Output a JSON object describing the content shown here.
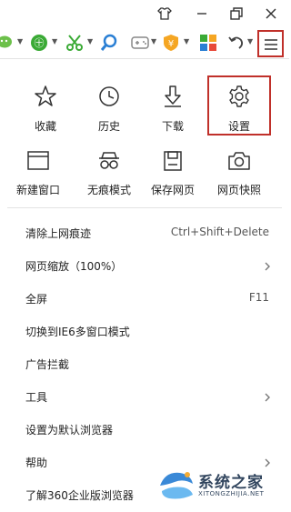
{
  "titlebar": {
    "icons": [
      "skin-icon",
      "minimize-icon",
      "restore-icon",
      "close-icon"
    ]
  },
  "toolbar": {
    "icons": [
      "wechat-icon",
      "green-circle-icon",
      "scissors-icon",
      "search-icon",
      "game-controller-icon",
      "shield-yen-icon",
      "apps-grid-icon",
      "undo-icon",
      "menu-icon"
    ]
  },
  "grid_row1": [
    {
      "label": "收藏",
      "icon": "star-icon"
    },
    {
      "label": "历史",
      "icon": "clock-icon"
    },
    {
      "label": "下载",
      "icon": "download-icon"
    },
    {
      "label": "设置",
      "icon": "gear-icon"
    }
  ],
  "grid_row2": [
    {
      "label": "新建窗口",
      "icon": "window-icon"
    },
    {
      "label": "无痕模式",
      "icon": "incognito-glasses-icon"
    },
    {
      "label": "保存网页",
      "icon": "save-icon"
    },
    {
      "label": "网页快照",
      "icon": "camera-icon"
    }
  ],
  "menu": [
    {
      "label": "清除上网痕迹",
      "right": "Ctrl+Shift+Delete"
    },
    {
      "label": "网页缩放（100%）",
      "right": ""
    },
    {
      "label": "全屏",
      "right": "F11"
    },
    {
      "label": "切换到IE6多窗口模式",
      "right": ""
    },
    {
      "label": "广告拦截",
      "right": ""
    },
    {
      "label": "工具",
      "right": ""
    },
    {
      "label": "设置为默认浏览器",
      "right": ""
    },
    {
      "label": "帮助",
      "right": ""
    },
    {
      "label": "了解360企业版浏览器",
      "right": ""
    }
  ],
  "watermark": {
    "title": "系统之家",
    "url": "XITONGZHIJIA.NET"
  },
  "colors": {
    "highlight": "#c0302a",
    "accent_green": "#3aaa35",
    "accent_blue": "#2a7fd4",
    "accent_orange": "#f5a623"
  }
}
